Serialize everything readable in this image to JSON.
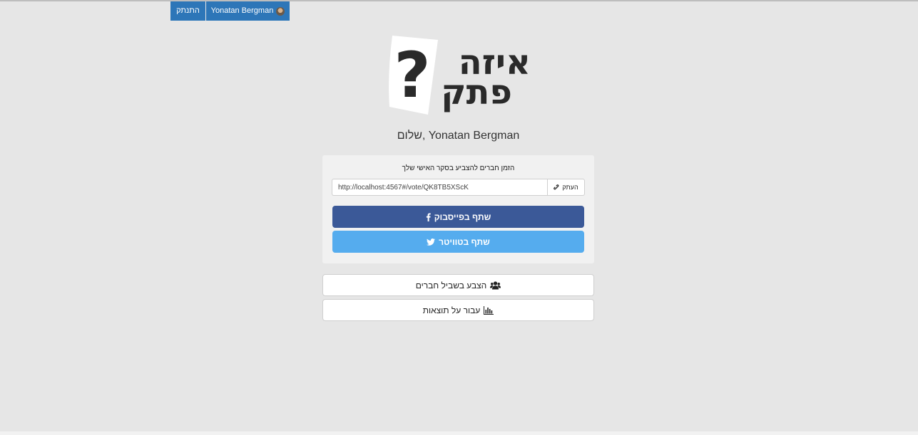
{
  "nav": {
    "logout_label": "התנתק",
    "user_name": "Yonatan Bergman"
  },
  "logo": {
    "line1": "איזה",
    "line2": "פתק",
    "symbol": "?"
  },
  "greeting": "שלום, Yonatan Bergman",
  "invite": {
    "text": "הזמן חברים להצביע בסקר האישי שלך",
    "url_value": "http://localhost:4567#/vote/QK8TB5XScK",
    "copy_label": "העתק"
  },
  "share": {
    "facebook_label": "שתף בפייסבוק",
    "twitter_label": "שתף בטוויטר"
  },
  "actions": {
    "vote_label": "הצבע בשביל חברים",
    "results_label": "עבור על תוצאות"
  },
  "colors": {
    "nav_blue": "#2d76b8",
    "facebook": "#3b5998",
    "twitter": "#55acee",
    "background": "#e6e6e6"
  },
  "icons": {
    "copy": "link-icon",
    "facebook": "facebook-icon",
    "twitter": "twitter-icon",
    "vote": "users-icon",
    "results": "bar-chart-icon",
    "avatar": "avatar"
  }
}
